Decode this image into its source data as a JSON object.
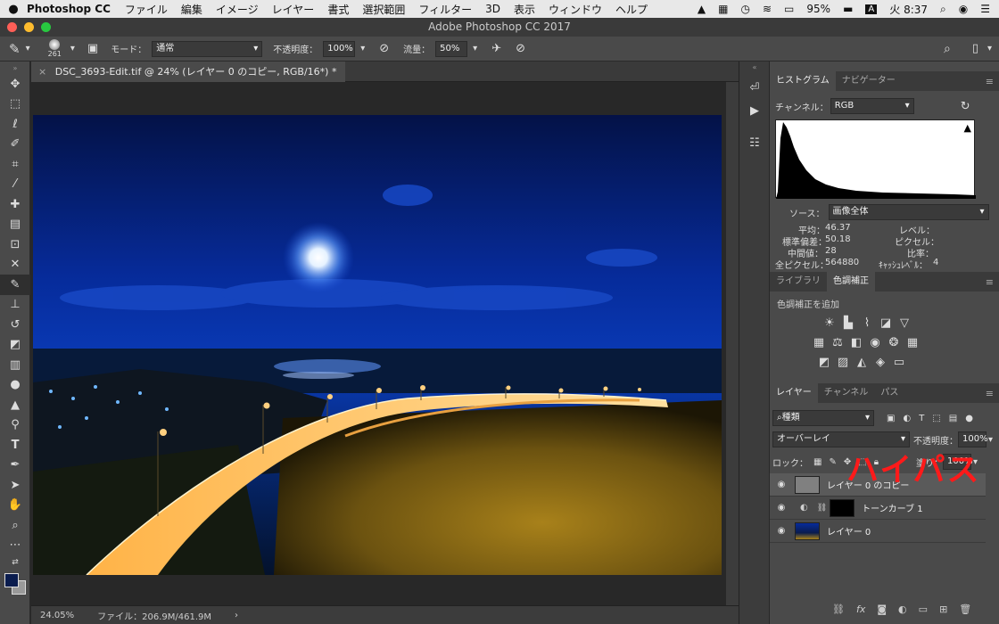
{
  "menubar": {
    "app": "Photoshop CC",
    "items": [
      "ファイル",
      "編集",
      "イメージ",
      "レイヤー",
      "書式",
      "選択範囲",
      "フィルター",
      "3D",
      "表示",
      "ウィンドウ",
      "ヘルプ"
    ],
    "battery": "95%",
    "input": "A",
    "clock": "火 8:37"
  },
  "window": {
    "title": "Adobe Photoshop CC 2017"
  },
  "options": {
    "brush_size": "261",
    "mode_label": "モード：",
    "mode_value": "通常",
    "opacity_label": "不透明度：",
    "opacity_value": "100%",
    "flow_label": "流量：",
    "flow_value": "50%"
  },
  "document": {
    "tab": "DSC_3693-Edit.tif @ 24% (レイヤー 0 のコピー, RGB/16*) *",
    "zoom": "24.05%",
    "file": "ファイル：206.9M/461.9M"
  },
  "histogram": {
    "tab1": "ヒストグラム",
    "tab2": "ナビゲーター",
    "channel_label": "チャンネル：",
    "channel_value": "RGB",
    "source_label": "ソース：",
    "source_value": "画像全体",
    "stats": {
      "mean_label": "平均：",
      "mean": "46.37",
      "std_label": "標準偏差：",
      "std": "50.18",
      "median_label": "中間値：",
      "median": "28",
      "pixels_label": "全ピクセル：",
      "pixels": "564880",
      "level_label": "レベル：",
      "count_label": "ピクセル：",
      "percent_label": "比率：",
      "cache_label": "ｷｬｯｼｭﾚﾍﾞﾙ：",
      "cache": "4"
    }
  },
  "adjust": {
    "tab1": "ライブラリ",
    "tab2": "色調補正",
    "add_label": "色調補正を追加"
  },
  "layers": {
    "tab1": "レイヤー",
    "tab2": "チャンネル",
    "tab3": "パス",
    "filter": "種類",
    "blend": "オーバーレイ",
    "opacity_label": "不透明度：",
    "opacity": "100%",
    "lock_label": "ロック：",
    "fill_label": "塗り：",
    "fill": "100%",
    "items": [
      {
        "name": "レイヤー 0 のコピー"
      },
      {
        "name": "トーンカーブ 1"
      },
      {
        "name": "レイヤー 0"
      }
    ]
  },
  "overlay_text": "ハイパス",
  "colors": {
    "accent_red": "#ff1a1a",
    "panel": "#4a4a4a",
    "fg_swatch": "#0a1c4e"
  }
}
